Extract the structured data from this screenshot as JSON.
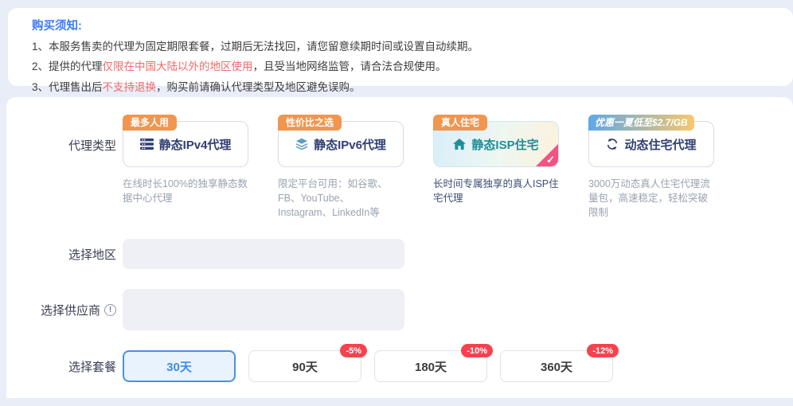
{
  "notice": {
    "title": "购买须知:",
    "items": [
      {
        "before": "1、本服务售卖的代理为固定期限套餐，过期后无法找回，请您留意续期时间或设置自动续期。",
        "highlight": "",
        "after": ""
      },
      {
        "before": "2、提供的代理",
        "highlight": "仅限在中国大陆以外的地区使用",
        "after": "，且受当地网络监管，请合法合规使用。"
      },
      {
        "before": "3、代理售出后",
        "highlight": "不支持退换",
        "after": "，购买前请确认代理类型及地区避免误购。"
      }
    ]
  },
  "form": {
    "type_label": "代理类型",
    "region_label": "选择地区",
    "supplier_label": "选择供应商",
    "package_label": "选择套餐",
    "cards": [
      {
        "badge": "最多人用",
        "title": "静态IPv4代理",
        "icon": "server-icon",
        "desc": "在线时长100%的独享静态数据中心代理",
        "selected": false
      },
      {
        "badge": "性价比之选",
        "title": "静态IPv6代理",
        "icon": "layers-icon",
        "desc": "限定平台可用：如谷歌、FB、YouTube、Instagram、LinkedIn等",
        "selected": false
      },
      {
        "badge": "真人住宅",
        "title": "静态ISP住宅",
        "icon": "home-icon",
        "desc": "长时间专属独享的真人ISP住宅代理",
        "selected": true
      },
      {
        "badge": "优惠一夏低至$2.7/GB",
        "title": "动态住宅代理",
        "icon": "refresh-icon",
        "desc": "3000万动态真人住宅代理流量包，高速稳定，轻松突破限制",
        "selected": false
      }
    ],
    "packages": [
      {
        "label": "30天",
        "discount": "",
        "selected": true
      },
      {
        "label": "90天",
        "discount": "-5%",
        "selected": false
      },
      {
        "label": "180天",
        "discount": "-10%",
        "selected": false
      },
      {
        "label": "360天",
        "discount": "-12%",
        "selected": false
      }
    ]
  },
  "icons": {
    "info_glyph": "!",
    "check_glyph": "✓"
  },
  "colors": {
    "page_background": "#e8edf8",
    "notice_title_blue": "#3b7bf0",
    "warning_red": "#f06a6a",
    "badge_orange": "#f0964f",
    "navy_title": "#2f3f72",
    "teal_selected": "#1f8e98",
    "selected_corner_pink": "#f2537f",
    "discount_red": "#f4434f",
    "accent_blue": "#4a90e2"
  }
}
